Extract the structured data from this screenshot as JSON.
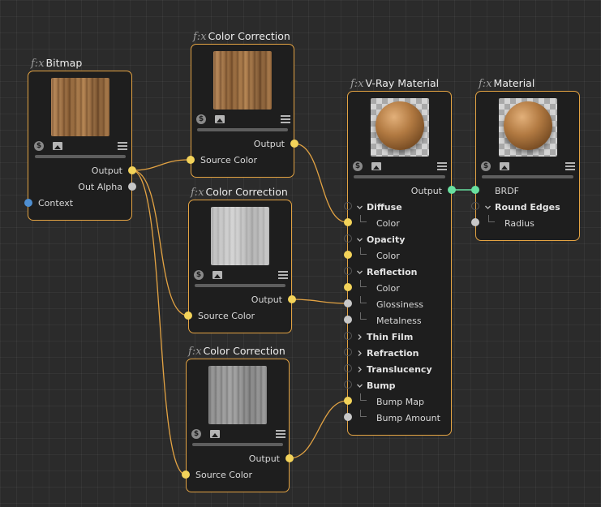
{
  "fx_glyph": "f:x",
  "nodes": {
    "bitmap": {
      "title": "Bitmap",
      "ports": {
        "output": "Output",
        "out_alpha": "Out Alpha",
        "context": "Context"
      }
    },
    "cc1": {
      "title": "Color Correction",
      "ports": {
        "output": "Output",
        "source_color": "Source Color"
      }
    },
    "cc2": {
      "title": "Color Correction",
      "ports": {
        "output": "Output",
        "source_color": "Source Color"
      }
    },
    "cc3": {
      "title": "Color Correction",
      "ports": {
        "output": "Output",
        "source_color": "Source Color"
      }
    },
    "vray": {
      "title": "V-Ray Material",
      "output": "Output",
      "groups": {
        "diffuse": "Diffuse",
        "diffuse_color": "Color",
        "opacity": "Opacity",
        "opacity_color": "Color",
        "reflection": "Reflection",
        "reflection_color": "Color",
        "glossiness": "Glossiness",
        "metalness": "Metalness",
        "thin_film": "Thin Film",
        "refraction": "Refraction",
        "translucency": "Translucency",
        "bump": "Bump",
        "bump_map": "Bump Map",
        "bump_amount": "Bump Amount"
      }
    },
    "material": {
      "title": "Material",
      "ports": {
        "brdf": "BRDF",
        "round_edges": "Round Edges",
        "radius": "Radius"
      }
    }
  },
  "colors": {
    "node_border": "#e3a343",
    "wire": "#e3a343",
    "port_yellow": "#f3d35a",
    "port_white": "#c8c8c8",
    "port_blue": "#4f8fd1",
    "port_green": "#68e0a0"
  },
  "icons": [
    "s-badge-icon",
    "image-icon",
    "menu-icon",
    "chevron-down-icon",
    "chevron-right-icon"
  ]
}
